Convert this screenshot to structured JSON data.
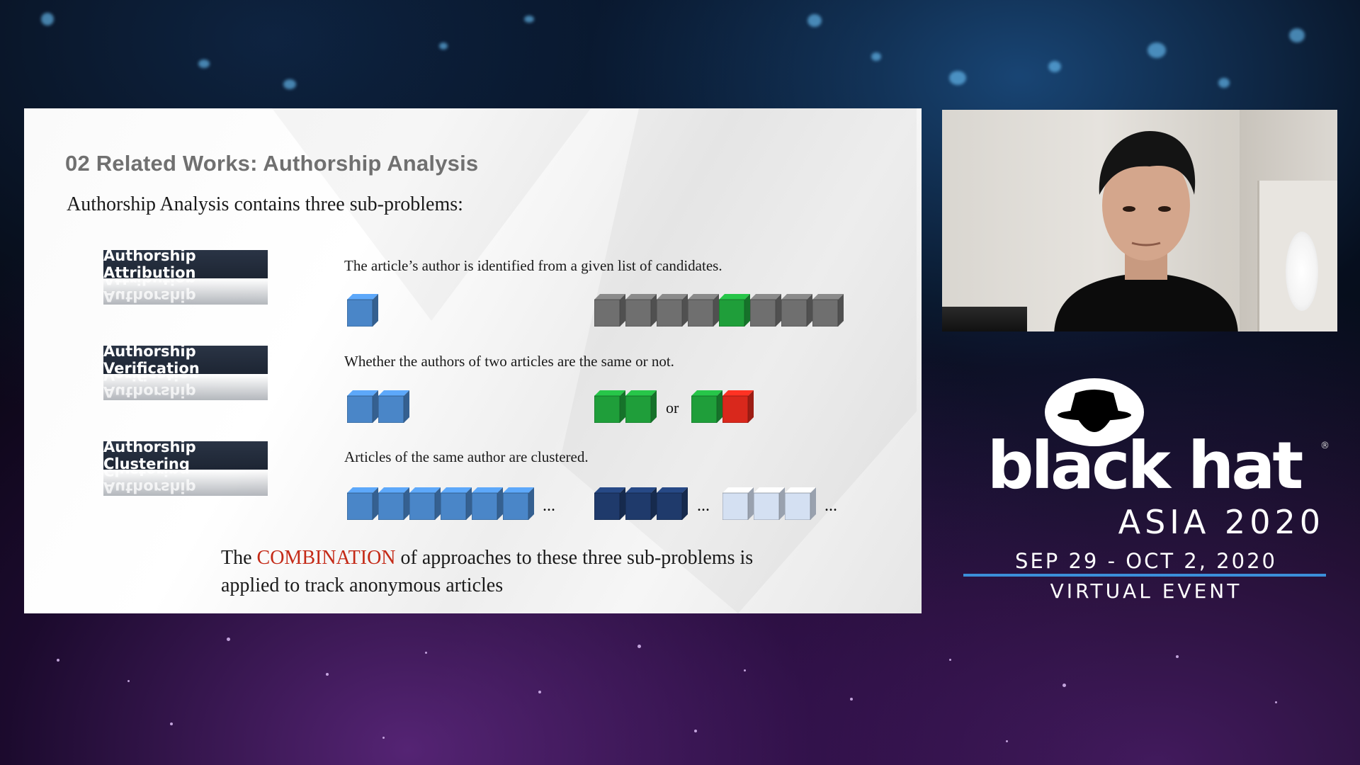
{
  "slide": {
    "title": "02 Related Works: Authorship Analysis",
    "subtitle": "Authorship Analysis contains three sub-problems:",
    "sections": [
      {
        "label": "Authorship Attribution",
        "description": "The article’s author is identified from a given list of candidates."
      },
      {
        "label": "Authorship Verification",
        "description": "Whether the authors of two articles are the same or not."
      },
      {
        "label": "Authorship Clustering",
        "description": "Articles of the same author are clustered."
      }
    ],
    "or_label": "or",
    "ellipsis": "...",
    "conclusion": {
      "before": "The ",
      "highlight": "COMBINATION",
      "after": " of approaches to these three sub-problems is applied to track anonymous articles"
    },
    "colors": {
      "blue": "#4a86c8",
      "gray": "#6f6f6f",
      "green": "#1f9e3a",
      "red": "#d9281c",
      "navy": "#1f3a6b",
      "light_blue": "#d4e0f2",
      "highlight": "#c42a17"
    }
  },
  "webcam": {
    "description_icon": "presenter-video"
  },
  "branding": {
    "logo_text": "black hat",
    "registered": "®",
    "event": "ASIA 2020",
    "dates": "SEP 29 - OCT 2, 2020",
    "mode": "VIRTUAL EVENT",
    "accent": "#3b8fd9"
  }
}
